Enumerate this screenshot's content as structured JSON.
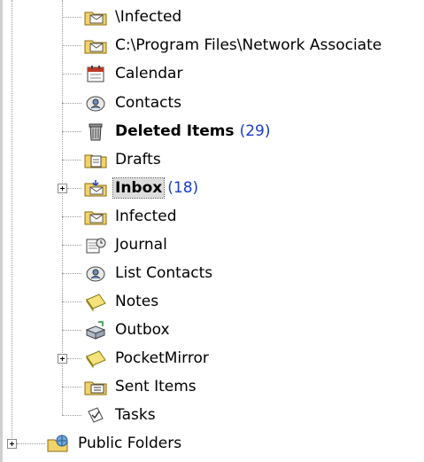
{
  "tree": {
    "items": [
      {
        "label": "\\Infected",
        "icon": "mail-folder-icon",
        "count": ""
      },
      {
        "label": "C:\\Program Files\\Network Associate",
        "icon": "mail-folder-icon",
        "count": ""
      },
      {
        "label": "Calendar",
        "icon": "calendar-icon",
        "count": ""
      },
      {
        "label": "Contacts",
        "icon": "contacts-icon",
        "count": ""
      },
      {
        "label": "Deleted Items",
        "icon": "trash-icon",
        "count": "(29)"
      },
      {
        "label": "Drafts",
        "icon": "drafts-icon",
        "count": ""
      },
      {
        "label": "Inbox",
        "icon": "inbox-icon",
        "count": "(18)"
      },
      {
        "label": "Infected",
        "icon": "mail-folder-icon",
        "count": ""
      },
      {
        "label": "Journal",
        "icon": "journal-icon",
        "count": ""
      },
      {
        "label": "List Contacts",
        "icon": "contacts-icon",
        "count": ""
      },
      {
        "label": "Notes",
        "icon": "notes-icon",
        "count": ""
      },
      {
        "label": "Outbox",
        "icon": "outbox-icon",
        "count": ""
      },
      {
        "label": "PocketMirror",
        "icon": "notes-icon",
        "count": ""
      },
      {
        "label": "Sent Items",
        "icon": "sent-items-icon",
        "count": ""
      },
      {
        "label": "Tasks",
        "icon": "tasks-icon",
        "count": ""
      }
    ],
    "public_folders": {
      "label": "Public Folders",
      "icon": "public-folders-icon"
    }
  },
  "colors": {
    "count": "#1a3cc8",
    "selected_bg": "#dcdcdc"
  }
}
